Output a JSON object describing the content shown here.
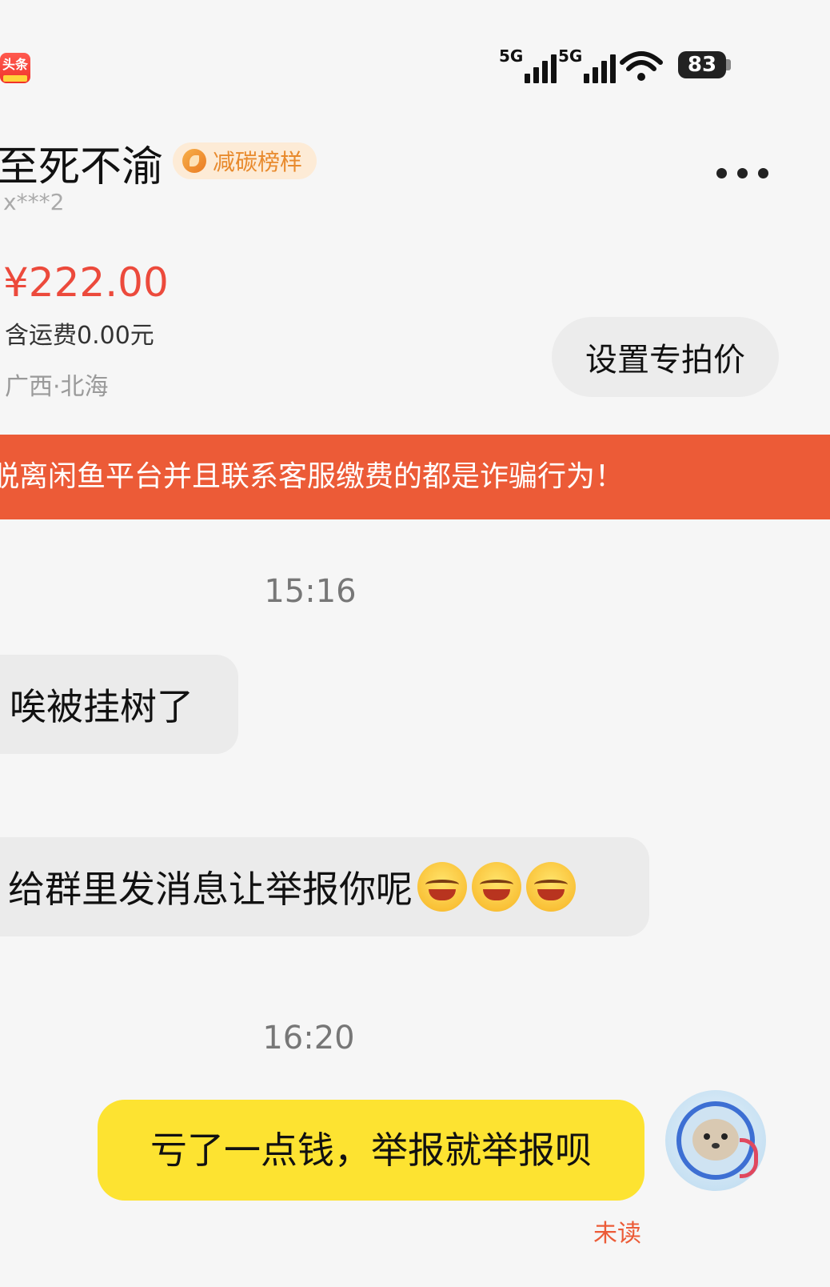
{
  "status_bar": {
    "app_badge": "头条",
    "signal1_label": "5G",
    "signal2_label": "5G",
    "battery": "83"
  },
  "header": {
    "username": "至死不渝",
    "badge": "减碳榜样",
    "masked_id": "x***2"
  },
  "item": {
    "price": "¥222.00",
    "shipping": "含运费0.00元",
    "location": "广西·北海",
    "set_price_button": "设置专拍价"
  },
  "warning_banner": "脱离闲鱼平台并且联系客服缴费的都是诈骗行为！",
  "chat": {
    "time1": "15:16",
    "msg1": "唉被挂树了",
    "msg2": "给群里发消息让举报你呢",
    "time2": "16:20",
    "msg3": "亏了一点钱，举报就举报呗",
    "read_status": "未读"
  },
  "colors": {
    "accent_red": "#ec4a3c",
    "banner_orange": "#ec5b37",
    "own_bubble_yellow": "#fde331",
    "badge_orange": "#e88a2d"
  }
}
